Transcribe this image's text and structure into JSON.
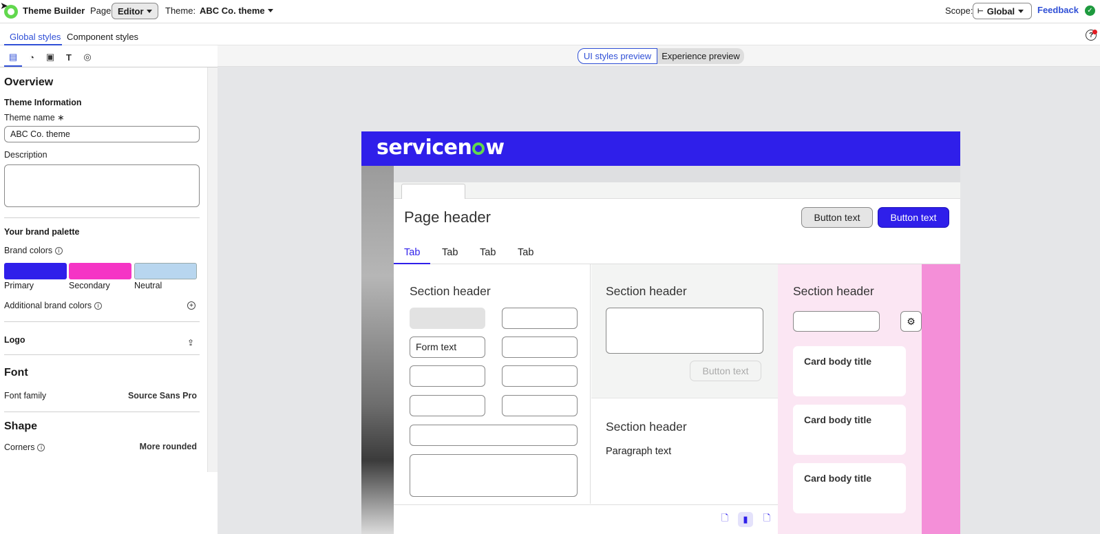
{
  "topbar": {
    "app_title": "Theme Builder",
    "page_label": "Page:",
    "page_value": "Editor",
    "theme_label": "Theme:",
    "theme_value": "ABC Co. theme",
    "scope_label": "Scope:",
    "scope_value": "Global",
    "feedback_label": "Feedback"
  },
  "style_tabs": [
    "Global styles",
    "Component styles"
  ],
  "left_panel": {
    "icon_tabs": [
      "layout-icon",
      "palette-icon",
      "images-icon",
      "text-icon",
      "shapes-icon"
    ],
    "overview_title": "Overview",
    "theme_info_title": "Theme Information",
    "theme_name_label": "Theme name",
    "required_mark": "∗",
    "theme_name_value": "ABC Co. theme",
    "description_label": "Description",
    "description_value": "",
    "brand_palette_title": "Your brand palette",
    "brand_colors_label": "Brand colors",
    "swatches": [
      {
        "label": "Primary",
        "color": "#2f1fea"
      },
      {
        "label": "Secondary",
        "color": "#f534c5"
      },
      {
        "label": "Neutral",
        "color": "#b8d6ef"
      }
    ],
    "additional_brand_label": "Additional brand colors",
    "logo_label": "Logo",
    "font_title": "Font",
    "font_family_label": "Font family",
    "font_family_value": "Source Sans Pro",
    "shape_title": "Shape",
    "corners_label": "Corners",
    "corners_value": "More rounded"
  },
  "preview": {
    "toggle_ui": "UI styles preview",
    "toggle_experience": "Experience preview",
    "brand_logo": {
      "prefix": "servicen",
      "suffix": "w"
    },
    "page_header": "Page header",
    "header_button_secondary": "Button text",
    "header_button_primary": "Button text",
    "tabs": [
      "Tab",
      "Tab",
      "Tab",
      "Tab"
    ],
    "section_header": "Section header",
    "form_text": "Form text",
    "disabled_button": "Button text",
    "paragraph": "Paragraph text",
    "cards": [
      "Card body title",
      "Card body title",
      "Card body title"
    ]
  },
  "colors": {
    "accent": "#2f4fd6",
    "primary": "#2f1fea",
    "secondary": "#f534c5",
    "neutral": "#b8d6ef"
  }
}
